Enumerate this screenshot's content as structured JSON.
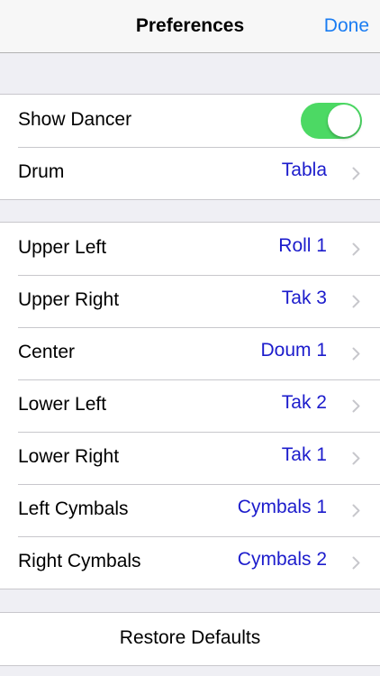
{
  "navbar": {
    "title": "Preferences",
    "done_label": "Done"
  },
  "general": {
    "show_dancer": {
      "label": "Show Dancer",
      "enabled": true
    },
    "drum": {
      "label": "Drum",
      "value": "Tabla"
    }
  },
  "sounds": [
    {
      "label": "Upper Left",
      "value": "Roll 1"
    },
    {
      "label": "Upper Right",
      "value": "Tak 3"
    },
    {
      "label": "Center",
      "value": "Doum 1"
    },
    {
      "label": "Lower Left",
      "value": "Tak 2"
    },
    {
      "label": "Lower Right",
      "value": "Tak 1"
    },
    {
      "label": "Left Cymbals",
      "value": "Cymbals 1"
    },
    {
      "label": "Right Cymbals",
      "value": "Cymbals 2"
    }
  ],
  "restore": {
    "label": "Restore Defaults"
  },
  "colors": {
    "accent": "#1a7cf2",
    "value_text": "#1c1ccc",
    "toggle_on": "#4cd964",
    "background": "#efeff4"
  },
  "icons": {
    "disclosure": "chevron-right-icon"
  }
}
